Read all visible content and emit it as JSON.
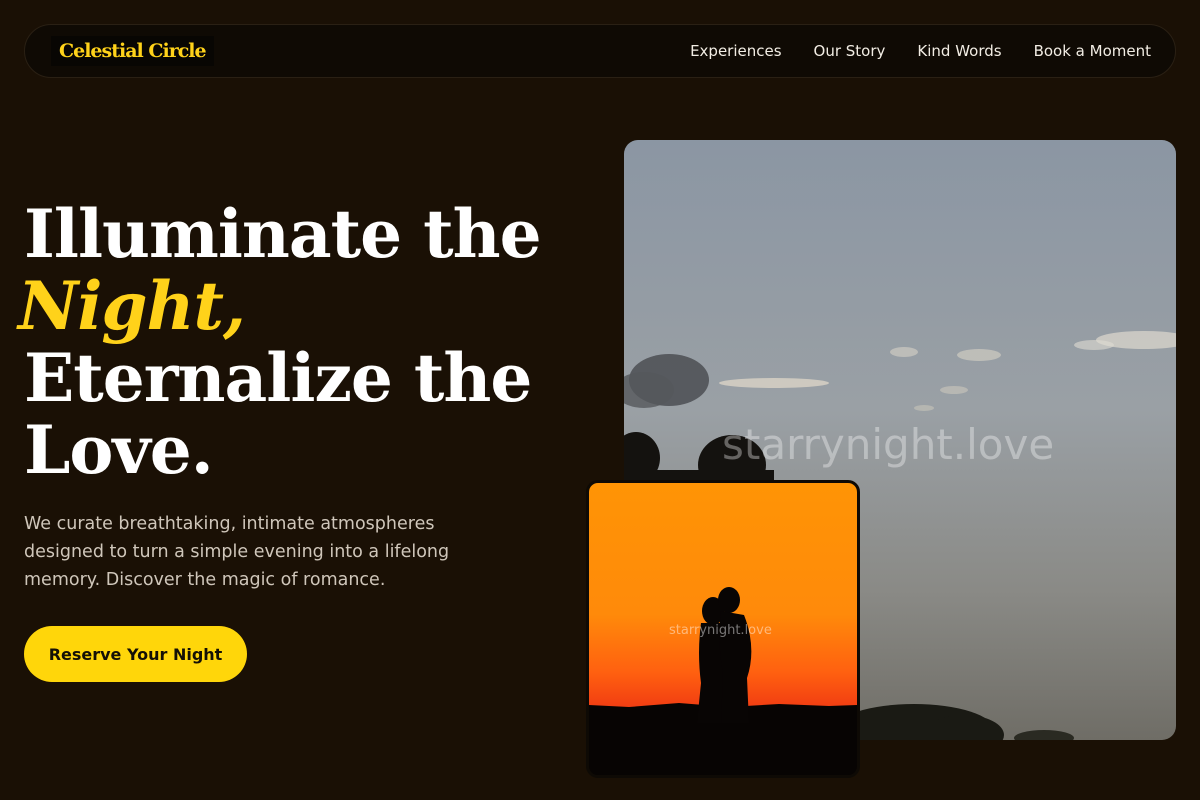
{
  "brand": {
    "name": "Celestial Circle"
  },
  "nav": {
    "links": [
      "Experiences",
      "Our Story",
      "Kind Words",
      "Book a Moment"
    ]
  },
  "hero": {
    "title_line1": "Illuminate the",
    "title_accent": "Night,",
    "title_line3": "Eternalize the",
    "title_line4": "Love.",
    "description": "We curate breathtaking, intimate atmospheres designed to turn a simple evening into a lifelong memory. Discover the magic of romance.",
    "cta_label": "Reserve Your Night"
  },
  "images": {
    "main_watermark": "starrynight.love",
    "small_watermark": "starrynight.love"
  },
  "colors": {
    "background": "#1a1005",
    "accent": "#ffd21a",
    "cta": "#ffd60a"
  }
}
